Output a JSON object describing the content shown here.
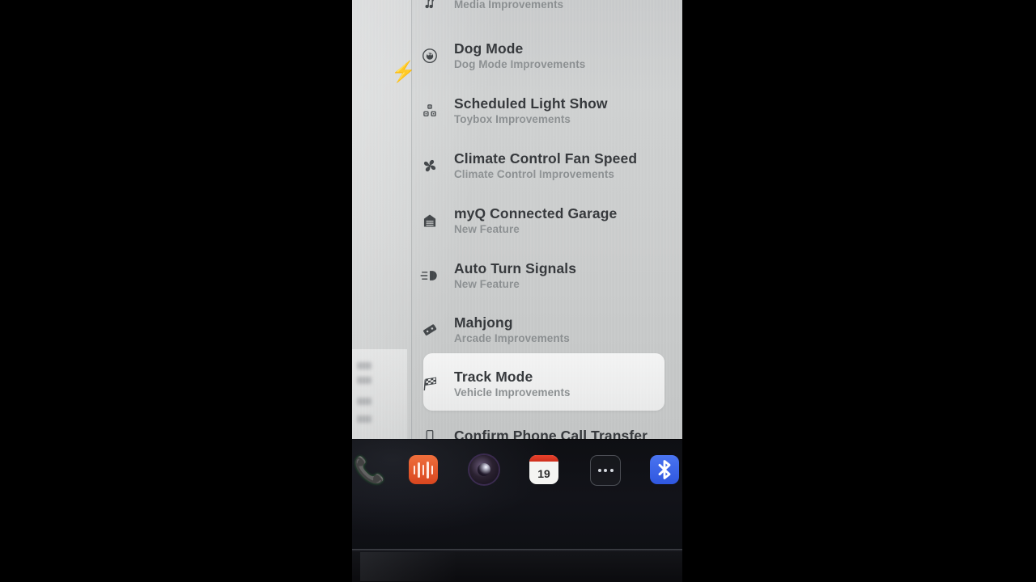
{
  "screen": {
    "kind": "vehicle-touchscreen-release-notes",
    "status_icon": "lightning-bolt-icon"
  },
  "release_notes": {
    "items": [
      {
        "icon": "music-notes-icon",
        "title": "",
        "subtitle": "Media Improvements",
        "selected": false,
        "clipped": true
      },
      {
        "icon": "dog-paw-circle-icon",
        "title": "Dog Mode",
        "subtitle": "Dog Mode Improvements",
        "selected": false,
        "clipped": false
      },
      {
        "icon": "light-show-cubes-icon",
        "title": "Scheduled Light Show",
        "subtitle": "Toybox Improvements",
        "selected": false,
        "clipped": false
      },
      {
        "icon": "fan-icon",
        "title": "Climate Control Fan Speed",
        "subtitle": "Climate Control Improvements",
        "selected": false,
        "clipped": false
      },
      {
        "icon": "garage-door-icon",
        "title": "myQ Connected Garage",
        "subtitle": "New Feature",
        "selected": false,
        "clipped": false
      },
      {
        "icon": "turn-signal-lamp-icon",
        "title": "Auto Turn Signals",
        "subtitle": "New Feature",
        "selected": false,
        "clipped": false
      },
      {
        "icon": "mahjong-tile-icon",
        "title": "Mahjong",
        "subtitle": "Arcade Improvements",
        "selected": false,
        "clipped": false
      },
      {
        "icon": "checkered-flag-icon",
        "title": "Track Mode",
        "subtitle": "Vehicle Improvements",
        "selected": true,
        "clipped": false
      },
      {
        "icon": "phone-transfer-icon",
        "title": "Confirm Phone Call Transfer",
        "subtitle": "",
        "selected": false,
        "clipped": true
      }
    ]
  },
  "dock": {
    "apps": [
      {
        "name": "phone-app",
        "icon": "phone-handset-icon",
        "label": ""
      },
      {
        "name": "voice-memos-app",
        "icon": "waveform-icon",
        "label": ""
      },
      {
        "name": "camera-app",
        "icon": "camera-lens-icon",
        "label": ""
      },
      {
        "name": "calendar-app",
        "icon": "calendar-icon",
        "label": "19"
      },
      {
        "name": "more-apps-button",
        "icon": "ellipsis-icon",
        "label": ""
      },
      {
        "name": "bluetooth-toggle",
        "icon": "bluetooth-icon",
        "label": ""
      }
    ]
  },
  "colors": {
    "panel_bg": "#cbcdcd",
    "title_text": "#36393c",
    "subtitle_text": "#8c9092",
    "selected_row": "#f2f2f0",
    "dock_bg": "#0e0f13",
    "bluetooth_blue": "#3a63e8",
    "voice_orange": "#e0561f",
    "calendar_red": "#d8311c",
    "phone_green": "#3fd34f"
  }
}
